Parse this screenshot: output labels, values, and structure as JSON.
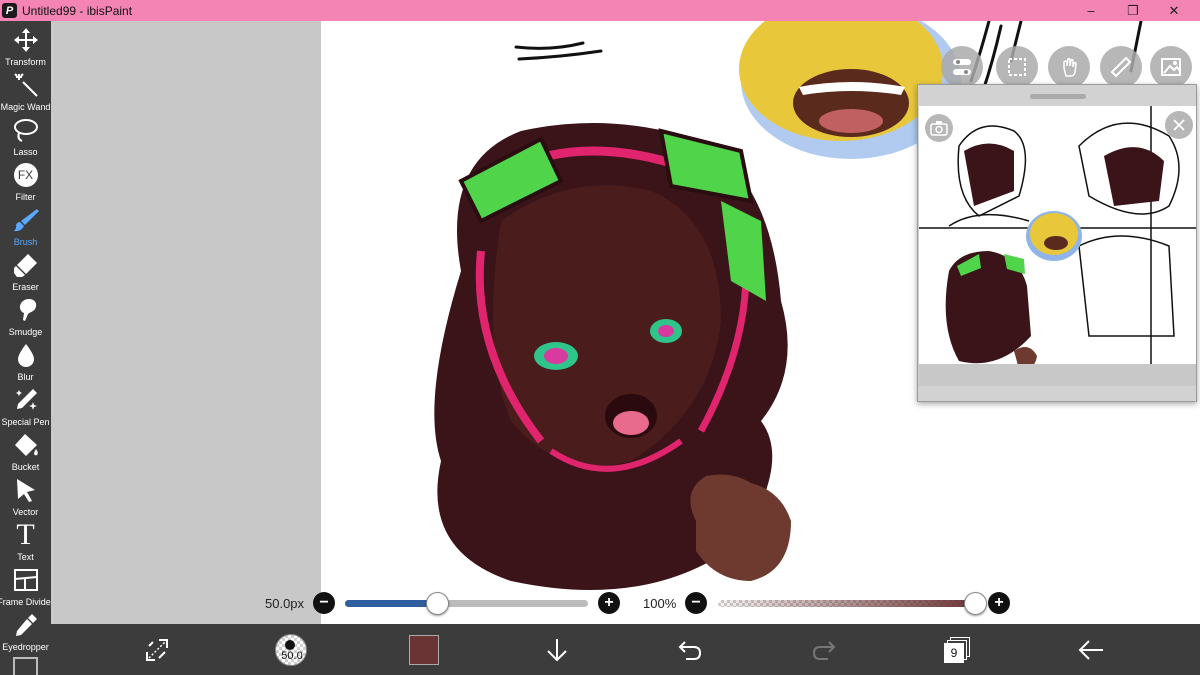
{
  "window": {
    "app_icon": "ibis-paint-icon",
    "title": "Untitled99 - ibisPaint",
    "minimize_icon": "minimize-icon",
    "restore_icon": "restore-icon",
    "close_icon": "close-icon"
  },
  "tools": [
    {
      "label": "Transform",
      "icon": "transform-icon"
    },
    {
      "label": "Magic Wand",
      "icon": "magic-wand-icon"
    },
    {
      "label": "Lasso",
      "icon": "lasso-icon"
    },
    {
      "label": "Filter",
      "icon": "fx-icon",
      "icon_text": "FX"
    },
    {
      "label": "Brush",
      "icon": "brush-icon",
      "active": true
    },
    {
      "label": "Eraser",
      "icon": "eraser-icon"
    },
    {
      "label": "Smudge",
      "icon": "smudge-icon"
    },
    {
      "label": "Blur",
      "icon": "blur-icon"
    },
    {
      "label": "Special Pen",
      "icon": "special-pen-icon"
    },
    {
      "label": "Bucket",
      "icon": "bucket-icon"
    },
    {
      "label": "Vector",
      "icon": "vector-icon"
    },
    {
      "label": "Text",
      "icon": "text-icon",
      "icon_text": "T"
    },
    {
      "label": "Frame Divider",
      "icon": "frame-divider-icon"
    },
    {
      "label": "Eyedropper",
      "icon": "eyedropper-icon"
    }
  ],
  "brush_size": {
    "value_label": "50.0px",
    "fraction": 0.38,
    "minus_label": "−",
    "plus_label": "+"
  },
  "opacity": {
    "value_label": "100%",
    "fraction": 1.0,
    "minus_label": "−",
    "plus_label": "+"
  },
  "bottom_bar": {
    "brush_preview_size": "50.0",
    "current_color": "#6b3434",
    "layer_count": "9"
  },
  "colors": {
    "titlebar": "#f484b4",
    "toolbar": "#3c3c3c",
    "active_tool": "#5aa8ff",
    "slider_fill": "#2f5f9e"
  }
}
